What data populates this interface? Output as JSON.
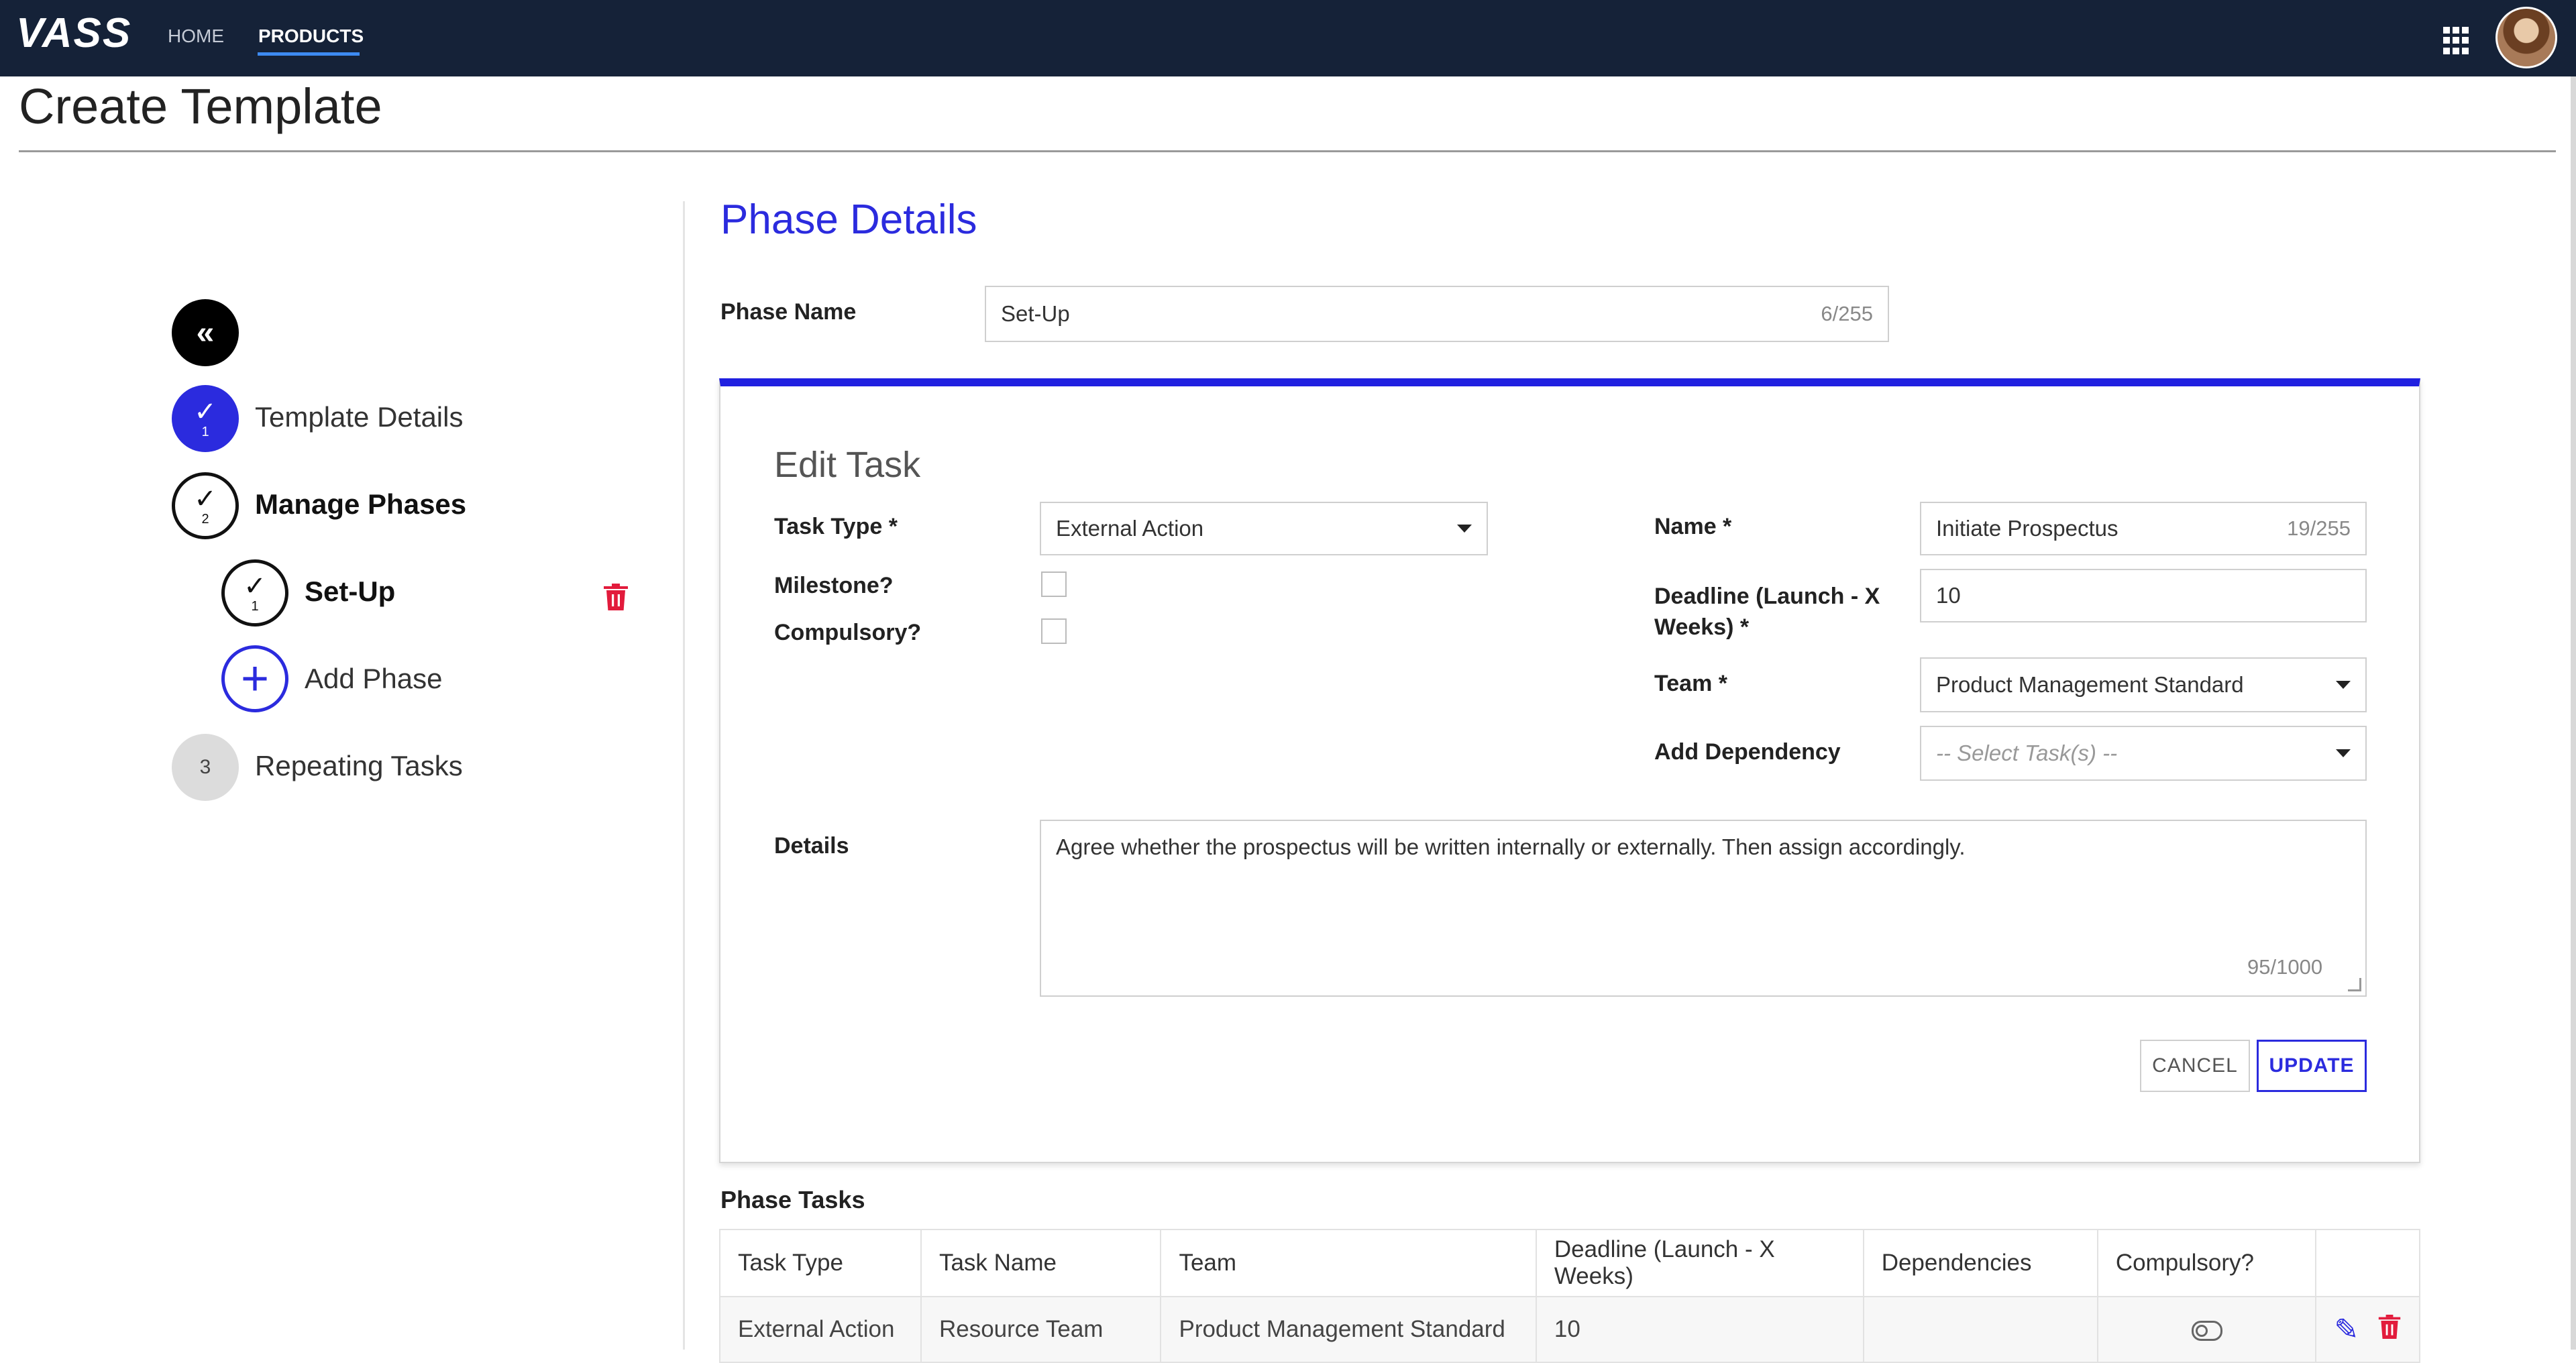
{
  "nav": {
    "logo": "VASS",
    "links": [
      {
        "label": "HOME"
      },
      {
        "label": "PRODUCTS",
        "active": true
      }
    ],
    "icons": [
      "apps-grid-icon",
      "user-avatar"
    ]
  },
  "page": {
    "title": "Create Template"
  },
  "stepper": {
    "steps": [
      {
        "label": "Template Details",
        "number": "1",
        "state": "complete"
      },
      {
        "label": "Manage Phases",
        "number": "2",
        "state": "current"
      },
      {
        "label": "Repeating Tasks",
        "number": "3",
        "state": "pending"
      }
    ],
    "phases": [
      {
        "label": "Set-Up",
        "number": "1"
      }
    ],
    "add_phase_label": "Add Phase"
  },
  "phase_details": {
    "heading": "Phase Details",
    "phase_name_label": "Phase Name",
    "phase_name_value": "Set-Up",
    "phase_name_counter": "6/255"
  },
  "edit_task": {
    "heading": "Edit Task",
    "task_type_label": "Task Type *",
    "task_type_value": "External Action",
    "milestone_label": "Milestone?",
    "milestone_checked": false,
    "compulsory_label": "Compulsory?",
    "compulsory_checked": false,
    "name_label": "Name *",
    "name_value": "Initiate Prospectus",
    "name_counter": "19/255",
    "deadline_label_line1": "Deadline (Launch - X",
    "deadline_label_line2": "Weeks) *",
    "deadline_value": "10",
    "team_label": "Team *",
    "team_value": "Product Management Standard",
    "dependency_label": "Add Dependency",
    "dependency_placeholder": "-- Select Task(s) --",
    "details_label": "Details",
    "details_value": "Agree whether the prospectus will be written internally or externally. Then assign accordingly.",
    "details_counter": "95/1000",
    "cancel_label": "CANCEL",
    "update_label": "UPDATE"
  },
  "phase_tasks": {
    "heading": "Phase Tasks",
    "columns": [
      "Task Type",
      "Task Name",
      "Team",
      "Deadline (Launch - X Weeks)",
      "Dependencies",
      "Compulsory?",
      ""
    ],
    "rows": [
      {
        "task_type": "External Action",
        "task_name": "Resource Team",
        "team": "Product Management Standard",
        "deadline": "10",
        "dependencies": ""
      }
    ]
  },
  "colors": {
    "nav_bg": "#152238",
    "accent": "#2b2bde",
    "danger": "#e21b3c"
  }
}
